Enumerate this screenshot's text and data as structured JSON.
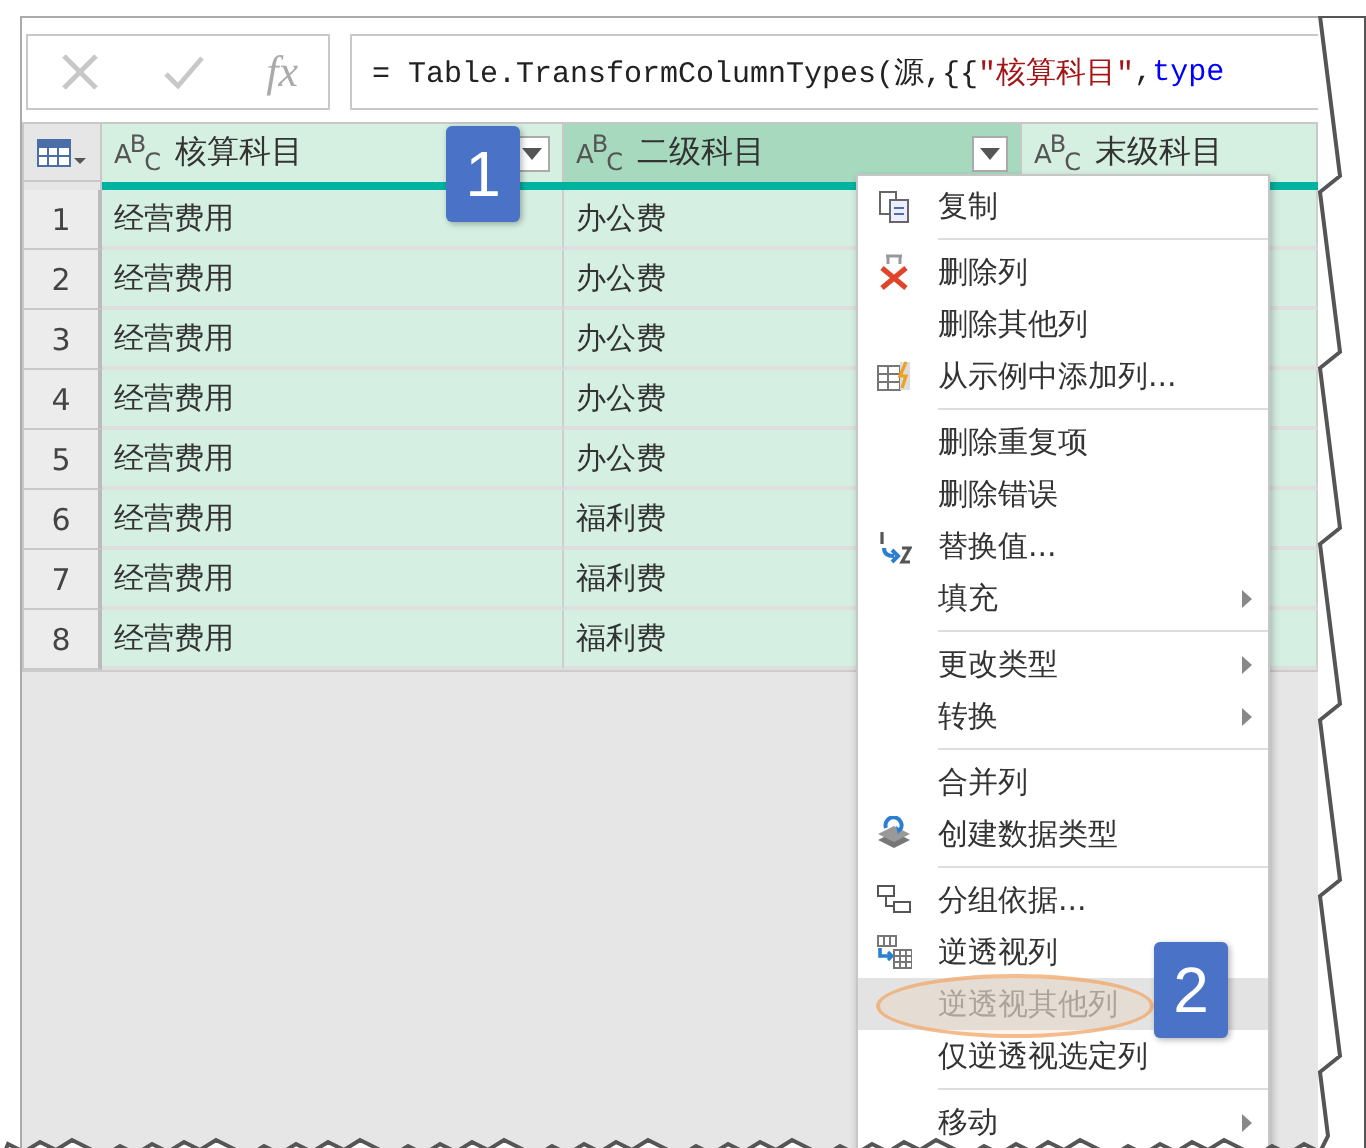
{
  "formula_bar": {
    "fx": "fx",
    "formula": [
      {
        "kind": "plain",
        "text": "= Table.TransformColumnTypes(源,{{"
      },
      {
        "kind": "string",
        "text": "\"核算科目\""
      },
      {
        "kind": "plain",
        "text": ", "
      },
      {
        "kind": "keyword",
        "text": "type"
      }
    ]
  },
  "table": {
    "columns": [
      {
        "type_icon": "A$^{B}$$_{C}$",
        "label": "核算科目",
        "selected": false,
        "filter_button": true
      },
      {
        "type_icon": "A$^{B}$$_{C}$",
        "label": "二级科目",
        "selected": true,
        "filter_button": true
      },
      {
        "type_icon": "A$^{B}$$_{C}$",
        "label": "末级科目",
        "selected": false,
        "filter_button": false
      }
    ],
    "rows": [
      {
        "number": "1",
        "cells": [
          "经营费用",
          "办公费"
        ]
      },
      {
        "number": "2",
        "cells": [
          "经营费用",
          "办公费"
        ]
      },
      {
        "number": "3",
        "cells": [
          "经营费用",
          "办公费"
        ]
      },
      {
        "number": "4",
        "cells": [
          "经营费用",
          "办公费"
        ]
      },
      {
        "number": "5",
        "cells": [
          "经营费用",
          "办公费"
        ]
      },
      {
        "number": "6",
        "cells": [
          "经营费用",
          "福利费"
        ]
      },
      {
        "number": "7",
        "cells": [
          "经营费用",
          "福利费"
        ]
      },
      {
        "number": "8",
        "cells": [
          "经营费用",
          "福利费"
        ]
      }
    ]
  },
  "context_menu": {
    "items": [
      {
        "label": "复制",
        "separator_before": false,
        "submenu": false,
        "selected": false
      },
      {
        "label": "删除列",
        "separator_before": true,
        "submenu": false,
        "selected": false
      },
      {
        "label": "删除其他列",
        "separator_before": false,
        "submenu": false,
        "selected": false
      },
      {
        "label": "从示例中添加列...",
        "separator_before": false,
        "submenu": false,
        "selected": false
      },
      {
        "label": "删除重复项",
        "separator_before": true,
        "submenu": false,
        "selected": false
      },
      {
        "label": "删除错误",
        "separator_before": false,
        "submenu": false,
        "selected": false
      },
      {
        "label": "替换值...",
        "separator_before": false,
        "submenu": false,
        "selected": false
      },
      {
        "label": "填充",
        "separator_before": false,
        "submenu": true,
        "selected": false
      },
      {
        "label": "更改类型",
        "separator_before": true,
        "submenu": true,
        "selected": false
      },
      {
        "label": "转换",
        "separator_before": false,
        "submenu": true,
        "selected": false
      },
      {
        "label": "合并列",
        "separator_before": true,
        "submenu": false,
        "selected": false
      },
      {
        "label": "创建数据类型",
        "separator_before": false,
        "submenu": false,
        "selected": false
      },
      {
        "label": "分组依据...",
        "separator_before": true,
        "submenu": false,
        "selected": false
      },
      {
        "label": "逆透视列",
        "separator_before": false,
        "submenu": false,
        "selected": false
      },
      {
        "label": "逆透视其他列",
        "separator_before": false,
        "submenu": false,
        "selected": true
      },
      {
        "label": "仅逆透视选定列",
        "separator_before": false,
        "submenu": false,
        "selected": false
      },
      {
        "label": "移动",
        "separator_before": true,
        "submenu": true,
        "selected": false
      }
    ]
  },
  "callouts": [
    {
      "text": "1"
    },
    {
      "text": "2"
    }
  ]
}
